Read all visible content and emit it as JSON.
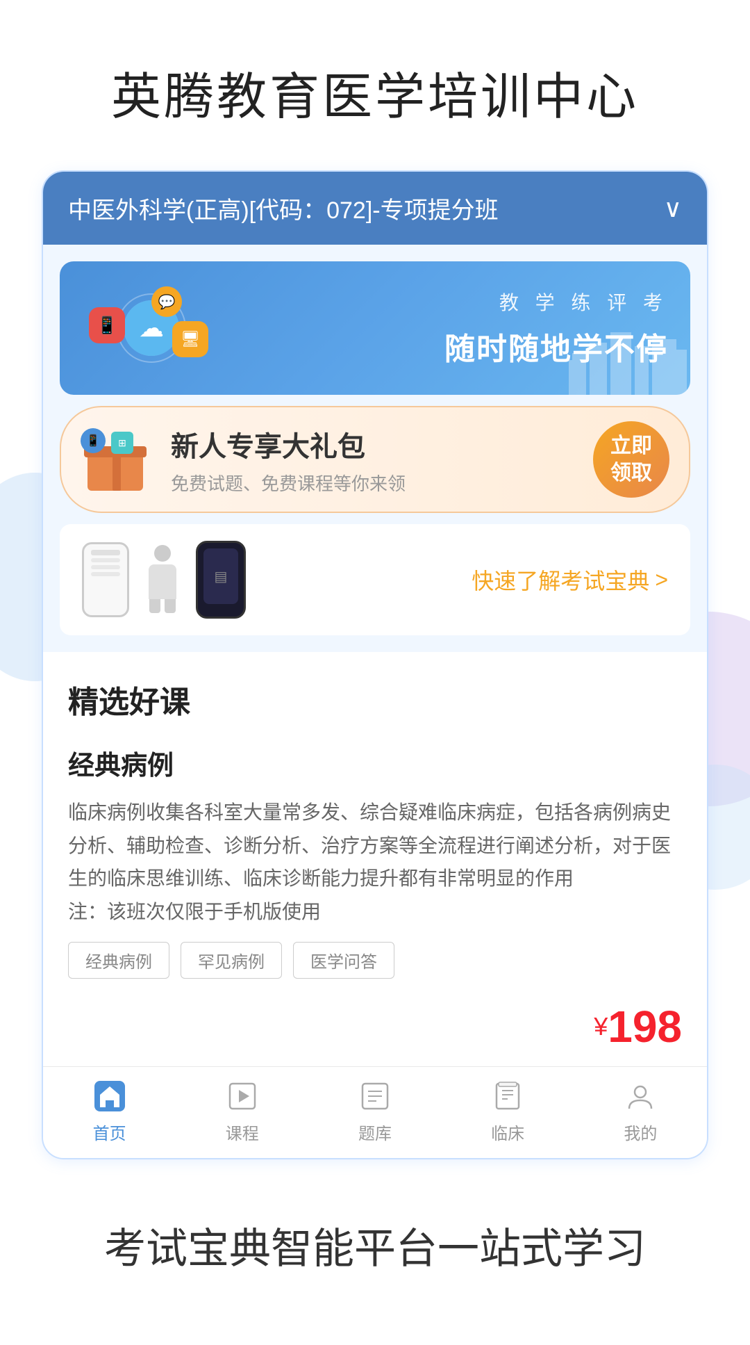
{
  "header": {
    "title": "英腾教育医学培训中心"
  },
  "course_selector": {
    "text": "中医外科学(正高)[代码：072]-专项提分班",
    "chevron": "∨"
  },
  "banner": {
    "subtitle": "教 学 练 评 考",
    "main_text": "随时随地学不停",
    "icons": [
      "☁",
      "📱",
      "🖥",
      "💬"
    ]
  },
  "gift": {
    "title": "新人专享大礼包",
    "subtitle": "免费试题、免费课程等你来领",
    "button_line1": "立即",
    "button_line2": "领取"
  },
  "exam_guide": {
    "link_text": "快速了解考试宝典",
    "arrow": ">"
  },
  "selected_courses": {
    "section_title": "精选好课",
    "course": {
      "name": "经典病例",
      "description": "临床病例收集各科室大量常多发、综合疑难临床病症，包括各病例病史分析、辅助检查、诊断分析、治疗方案等全流程进行阐述分析，对于医生的临床思维训练、临床诊断能力提升都有非常明显的作用\n注：该班次仅限于手机版使用",
      "tags": [
        "经典病例",
        "罕见病例",
        "医学问答"
      ],
      "price_symbol": "¥",
      "price": "198"
    }
  },
  "bottom_nav": {
    "items": [
      {
        "icon": "🏠",
        "label": "首页",
        "active": true
      },
      {
        "icon": "▶",
        "label": "课程",
        "active": false
      },
      {
        "icon": "☰",
        "label": "题库",
        "active": false
      },
      {
        "icon": "📋",
        "label": "临床",
        "active": false
      },
      {
        "icon": "👤",
        "label": "我的",
        "active": false
      }
    ]
  },
  "footer": {
    "title": "考试宝典智能平台一站式学习"
  }
}
